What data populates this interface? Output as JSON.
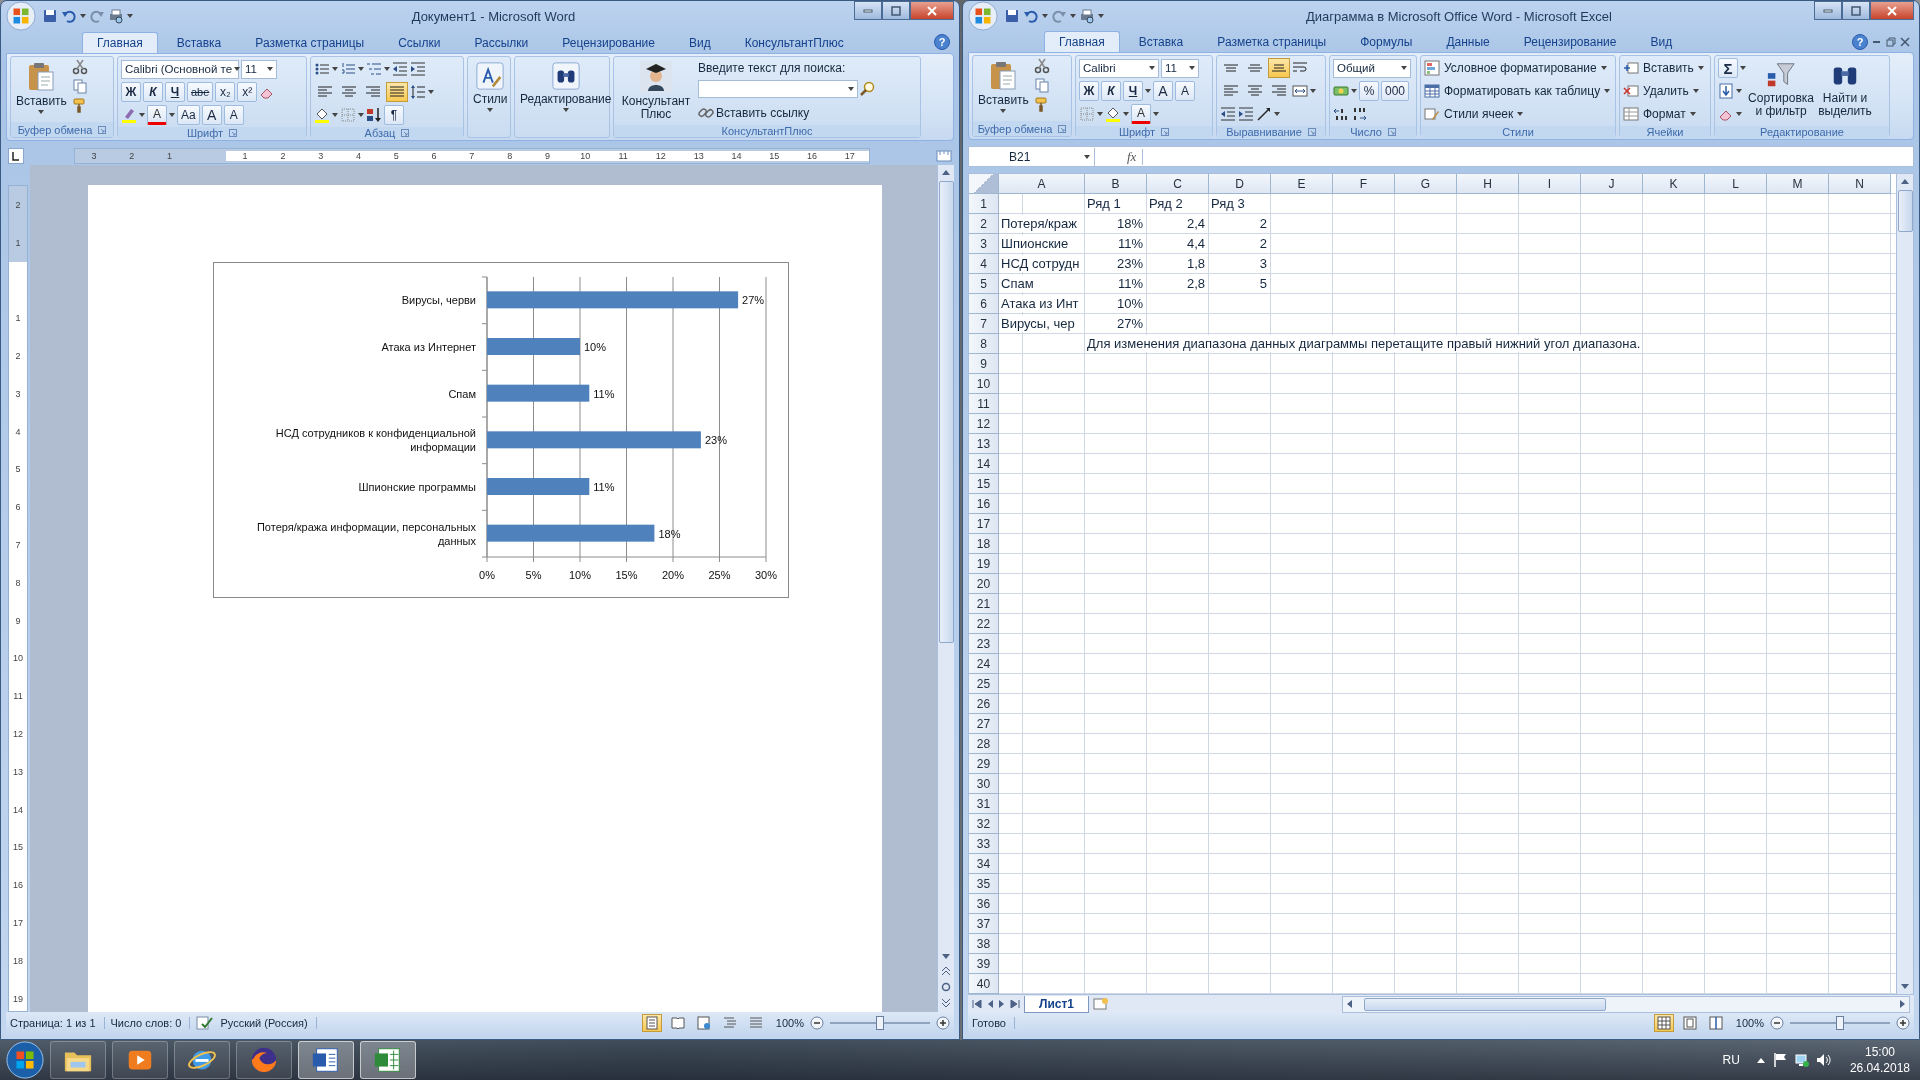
{
  "word": {
    "title": "Документ1 - Microsoft Word",
    "help": "?",
    "tabs": [
      {
        "label": "Главная",
        "selected": true
      },
      {
        "label": "Вставка",
        "selected": false
      },
      {
        "label": "Разметка страницы",
        "selected": false
      },
      {
        "label": "Ссылки",
        "selected": false
      },
      {
        "label": "Рассылки",
        "selected": false
      },
      {
        "label": "Рецензирование",
        "selected": false
      },
      {
        "label": "Вид",
        "selected": false
      },
      {
        "label": "КонсультантПлюс",
        "selected": false
      }
    ],
    "clipboard": {
      "paste": "Вставить",
      "label": "Буфер обмена"
    },
    "font": {
      "family": "Calibri (Основной те",
      "size": "11",
      "styles": [
        "Ж",
        "К",
        "Ч",
        "abe",
        "x₂",
        "x²"
      ],
      "font_color": "A",
      "case": "Aa",
      "grow": "A",
      "shrink": "A",
      "label": "Шрифт"
    },
    "paragraph": {
      "alignment": [
        {
          "kind": "left",
          "selected": false
        },
        {
          "kind": "center",
          "selected": false
        },
        {
          "kind": "right",
          "selected": false
        },
        {
          "kind": "justify",
          "selected": true
        }
      ],
      "pilcrow": "¶",
      "label": "Абзац"
    },
    "styles": {
      "button": "Стили"
    },
    "editing": {
      "button": "Редактирование"
    },
    "consultant": {
      "button": "Консультант Плюс",
      "search_label": "Введите текст для поиска:",
      "link": "Вставить ссылку",
      "label": "КонсультантПлюс"
    },
    "ruler": [
      {
        "kind": "margin",
        "label": "3"
      },
      {
        "kind": "margin",
        "label": "2"
      },
      {
        "kind": "margin",
        "label": "1"
      },
      {
        "kind": "page",
        "label": "1"
      },
      {
        "kind": "page",
        "label": "2"
      },
      {
        "kind": "page",
        "label": "3"
      },
      {
        "kind": "page",
        "label": "4"
      },
      {
        "kind": "page",
        "label": "5"
      },
      {
        "kind": "page",
        "label": "6"
      },
      {
        "kind": "page",
        "label": "7"
      },
      {
        "kind": "page",
        "label": "8"
      },
      {
        "kind": "page",
        "label": "9"
      },
      {
        "kind": "page",
        "label": "10"
      },
      {
        "kind": "page",
        "label": "11"
      },
      {
        "kind": "page",
        "label": "12"
      },
      {
        "kind": "page",
        "label": "13"
      },
      {
        "kind": "page",
        "label": "14"
      },
      {
        "kind": "page",
        "label": "15"
      },
      {
        "kind": "page",
        "label": "16"
      },
      {
        "kind": "page",
        "label": "17"
      }
    ],
    "vertical_ruler": [
      {
        "kind": "margin",
        "label": "2"
      },
      {
        "kind": "margin",
        "label": "1"
      },
      {
        "kind": "page",
        "label": "1"
      },
      {
        "kind": "page",
        "label": "2"
      },
      {
        "kind": "page",
        "label": "3"
      },
      {
        "kind": "page",
        "label": "4"
      },
      {
        "kind": "page",
        "label": "5"
      },
      {
        "kind": "page",
        "label": "6"
      },
      {
        "kind": "page",
        "label": "7"
      },
      {
        "kind": "page",
        "label": "8"
      },
      {
        "kind": "page",
        "label": "9"
      },
      {
        "kind": "page",
        "label": "10"
      },
      {
        "kind": "page",
        "label": "11"
      },
      {
        "kind": "page",
        "label": "12"
      },
      {
        "kind": "page",
        "label": "13"
      },
      {
        "kind": "page",
        "label": "14"
      },
      {
        "kind": "page",
        "label": "15"
      },
      {
        "kind": "page",
        "label": "16"
      },
      {
        "kind": "page",
        "label": "17"
      },
      {
        "kind": "page",
        "label": "18"
      },
      {
        "kind": "page",
        "label": "19"
      }
    ],
    "chart_data": {
      "type": "bar",
      "orientation": "horizontal",
      "grid": true,
      "categories": [
        "Вирусы, черви",
        "Атака из Интернет",
        "Спам",
        "НСД сотрудников к конфиденциальной информации",
        "Шпионские программы",
        "Потеря/кража информации, персональных данных"
      ],
      "values": [
        0.27,
        0.1,
        0.11,
        0.23,
        0.11,
        0.18
      ],
      "value_labels": [
        "27%",
        "10%",
        "11%",
        "23%",
        "11%",
        "18%"
      ],
      "xlim": [
        0,
        0.3
      ],
      "xticks": [
        {
          "value": 0,
          "label": "0%"
        },
        {
          "value": 0.05,
          "label": "5%"
        },
        {
          "value": 0.1,
          "label": "10%"
        },
        {
          "value": 0.15,
          "label": "15%"
        },
        {
          "value": 0.2,
          "label": "20%"
        },
        {
          "value": 0.25,
          "label": "25%"
        },
        {
          "value": 0.3,
          "label": "30%"
        }
      ]
    },
    "status_bar": {
      "page": "Страница: 1 из 1",
      "words": "Число слов: 0",
      "language": "Русский (Россия)",
      "views": [
        {
          "kind": "print",
          "selected": true
        },
        {
          "kind": "read",
          "selected": false
        },
        {
          "kind": "web",
          "selected": false
        },
        {
          "kind": "outline",
          "selected": false
        },
        {
          "kind": "draft",
          "selected": false
        }
      ],
      "zoom": "100%",
      "zoom_slider": {
        "level": 0.5
      }
    }
  },
  "excel": {
    "title": "Диаграмма в Microsoft Office Word - Microsoft Excel",
    "help": "?",
    "tabs": [
      {
        "label": "Главная",
        "selected": true
      },
      {
        "label": "Вставка",
        "selected": false
      },
      {
        "label": "Разметка страницы",
        "selected": false
      },
      {
        "label": "Формулы",
        "selected": false
      },
      {
        "label": "Данные",
        "selected": false
      },
      {
        "label": "Рецензирование",
        "selected": false
      },
      {
        "label": "Вид",
        "selected": false
      }
    ],
    "clipboard": {
      "paste": "Вставить",
      "label": "Буфер обмена"
    },
    "font": {
      "family": "Calibri",
      "size": "11",
      "styles": [
        "Ж",
        "К",
        "Ч"
      ],
      "font_color": "A",
      "grow": "A",
      "shrink": "A",
      "label": "Шрифт"
    },
    "alignment": {
      "vertical": [
        {
          "kind": "top",
          "selected": false
        },
        {
          "kind": "middle",
          "selected": false
        },
        {
          "kind": "bottom",
          "selected": true
        }
      ],
      "horizontal": [
        {
          "kind": "left",
          "selected": false
        },
        {
          "kind": "center",
          "selected": false
        },
        {
          "kind": "right",
          "selected": false
        }
      ],
      "label": "Выравнивание"
    },
    "number": {
      "format": "Общий",
      "percent": "%",
      "thousands": "000",
      "label": "Число"
    },
    "styles": {
      "items": [
        "Условное форматирование",
        "Форматировать как таблицу",
        "Стили ячеек"
      ],
      "label": "Стили"
    },
    "cells": {
      "items": [
        "Вставить",
        "Удалить",
        "Формат"
      ],
      "label": "Ячейки"
    },
    "editing": {
      "sum": "Σ",
      "sort": "Сортировка и фильтр",
      "find": "Найти и выделить",
      "label": "Редактирование"
    },
    "name_box": "B21",
    "fx": "fx",
    "columns": [
      "A",
      "B",
      "C",
      "D",
      "E",
      "F",
      "G",
      "H",
      "I",
      "J",
      "K",
      "L",
      "M",
      "N"
    ],
    "rows": [
      {
        "n": "1",
        "cells": [
          null,
          {
            "text": "Ряд 1",
            "numeric": false
          },
          {
            "text": "Ряд 2",
            "numeric": false
          },
          {
            "text": "Ряд 3",
            "numeric": false
          }
        ]
      },
      {
        "n": "2",
        "cells": [
          {
            "text": "Потеря/краж",
            "numeric": false
          },
          {
            "text": "18%",
            "numeric": true
          },
          {
            "text": "2,4",
            "numeric": true
          },
          {
            "text": "2",
            "numeric": true
          }
        ]
      },
      {
        "n": "3",
        "cells": [
          {
            "text": "Шпионские",
            "numeric": false
          },
          {
            "text": "11%",
            "numeric": true
          },
          {
            "text": "4,4",
            "numeric": true
          },
          {
            "text": "2",
            "numeric": true
          }
        ]
      },
      {
        "n": "4",
        "cells": [
          {
            "text": "НСД сотрудн",
            "numeric": false
          },
          {
            "text": "23%",
            "numeric": true
          },
          {
            "text": "1,8",
            "numeric": true
          },
          {
            "text": "3",
            "numeric": true
          }
        ]
      },
      {
        "n": "5",
        "cells": [
          {
            "text": "Спам",
            "numeric": false
          },
          {
            "text": "11%",
            "numeric": true
          },
          {
            "text": "2,8",
            "numeric": true
          },
          {
            "text": "5",
            "numeric": true
          }
        ]
      },
      {
        "n": "6",
        "cells": [
          {
            "text": "Атака из Инт",
            "numeric": false
          },
          {
            "text": "10%",
            "numeric": true
          }
        ]
      },
      {
        "n": "7",
        "cells": [
          {
            "text": "Вирусы, чер",
            "numeric": false
          },
          {
            "text": "27%",
            "numeric": true
          }
        ]
      },
      {
        "n": "8",
        "cells": [
          null,
          {
            "text": "Для изменения диапазона данных диаграммы перетащите правый нижний угол диапазона.",
            "numeric": false
          }
        ]
      },
      {
        "n": "9"
      },
      {
        "n": "10"
      },
      {
        "n": "11"
      },
      {
        "n": "12"
      },
      {
        "n": "13"
      },
      {
        "n": "14"
      },
      {
        "n": "15"
      },
      {
        "n": "16"
      },
      {
        "n": "17"
      },
      {
        "n": "18"
      },
      {
        "n": "19"
      },
      {
        "n": "20"
      },
      {
        "n": "21"
      },
      {
        "n": "22"
      },
      {
        "n": "23"
      },
      {
        "n": "24"
      },
      {
        "n": "25"
      },
      {
        "n": "26"
      },
      {
        "n": "27"
      },
      {
        "n": "28"
      },
      {
        "n": "29"
      },
      {
        "n": "30"
      },
      {
        "n": "31"
      },
      {
        "n": "32"
      },
      {
        "n": "33"
      },
      {
        "n": "34"
      },
      {
        "n": "35"
      },
      {
        "n": "36"
      },
      {
        "n": "37"
      },
      {
        "n": "38"
      },
      {
        "n": "39"
      },
      {
        "n": "40"
      }
    ],
    "sheet_tabs": [
      {
        "label": "Лист1",
        "selected": true
      }
    ],
    "status_bar": {
      "text": "Готово",
      "views": [
        {
          "kind": "normal",
          "selected": true
        },
        {
          "kind": "pagelayout",
          "selected": false
        },
        {
          "kind": "pagebreak",
          "selected": false
        }
      ],
      "zoom": "100%",
      "zoom_slider": {
        "level": 0.5
      }
    }
  },
  "taskbar": {
    "language": "RU",
    "time": "15:00",
    "date": "26.04.2018"
  }
}
